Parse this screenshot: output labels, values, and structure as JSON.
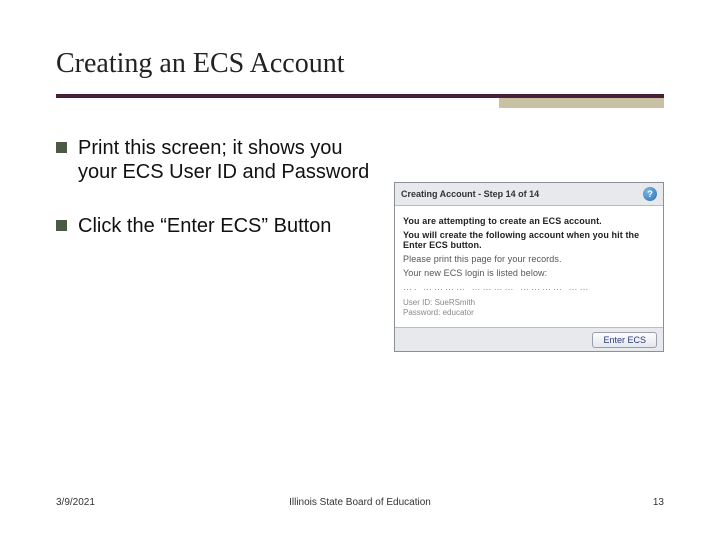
{
  "title": "Creating an ECS Account",
  "bullets": [
    "Print this screen; it shows you your ECS User ID and Password",
    "Click the “Enter ECS” Button"
  ],
  "screenshot": {
    "header": "Creating Account - Step 14 of 14",
    "help_glyph": "?",
    "line1": "You are attempting to create an ECS account.",
    "line2": "You will create the following account when you hit the Enter ECS button.",
    "line3": "Please print this page for your records.",
    "line4": "Your new ECS login is listed below:",
    "dots": "….      …………      …………      …………    ……",
    "cred_user_label": "User ID:",
    "cred_user_value": "SueRSmith",
    "cred_pw_label": "Password:",
    "cred_pw_value": "educator",
    "button": "Enter ECS"
  },
  "footer": {
    "date": "3/9/2021",
    "org": "Illinois State Board of Education",
    "page": "13"
  }
}
